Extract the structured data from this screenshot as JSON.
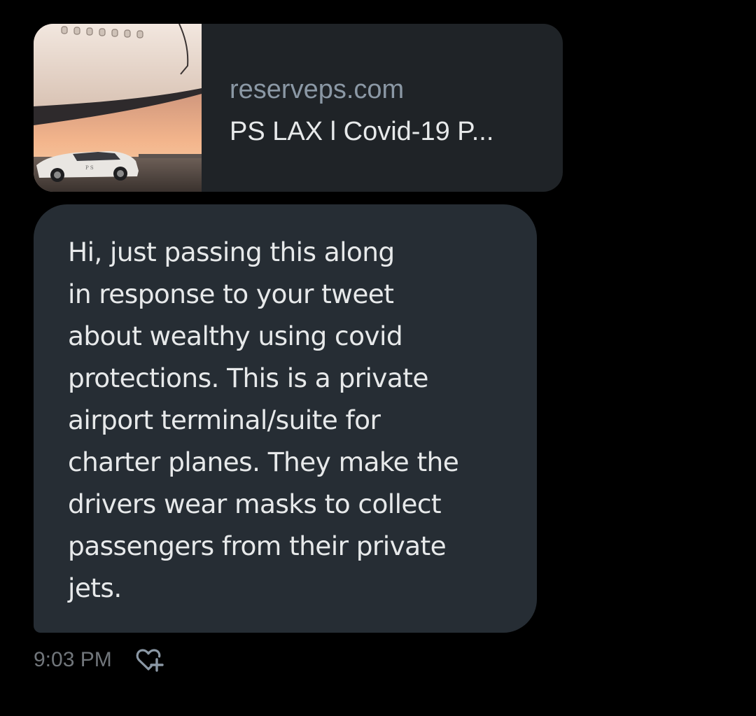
{
  "link_card": {
    "domain": "reserveps.com",
    "title": "PS LAX l Covid-19 P..."
  },
  "message": {
    "lines": [
      "Hi, just passing this along",
      "in response to your tweet",
      "about wealthy using covid",
      "protections. This is a private",
      "airport terminal/suite for",
      "charter planes. They make the",
      "drivers wear masks to collect",
      "passengers from their private",
      "jets."
    ],
    "timestamp": "9:03 PM",
    "reaction_icon": "heart-plus-icon"
  },
  "colors": {
    "background": "#000000",
    "card_bg": "#1f2327",
    "bubble_bg": "#262d34",
    "text_primary": "#e7e9ea",
    "text_secondary": "#8b98a5",
    "timestamp": "#71767b"
  }
}
